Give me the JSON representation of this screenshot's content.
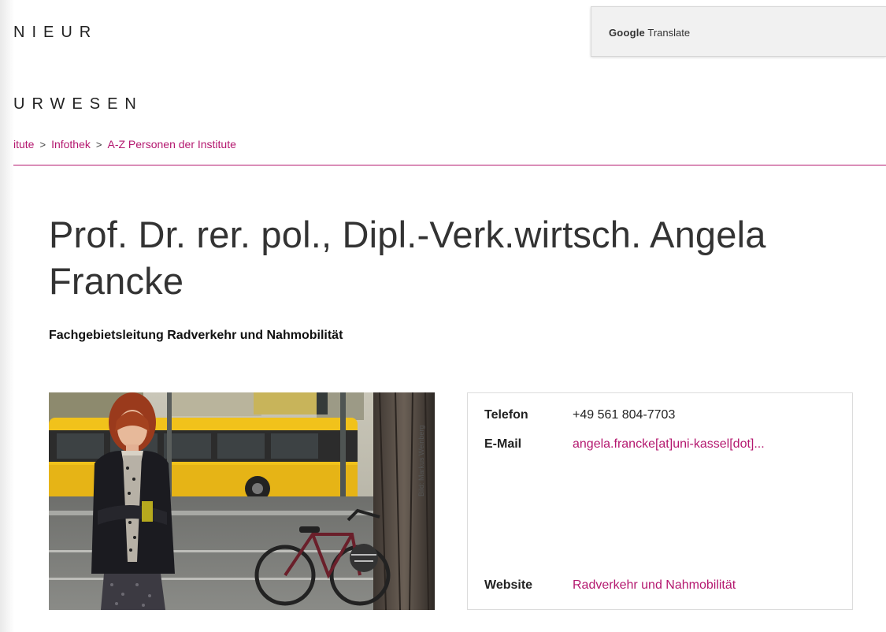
{
  "header": {
    "faculty_line1": "NIEUR",
    "faculty_line2": "URWESEN"
  },
  "translate": {
    "brand": "Google",
    "label": "Translate"
  },
  "breadcrumb": [
    {
      "label": "itute"
    },
    {
      "label": "Infothek"
    },
    {
      "label": "A-Z Personen der Institute"
    }
  ],
  "breadcrumb_separator": ">",
  "person": {
    "title": "Prof. Dr. rer. pol., Dipl.-Verk.wirtsch. Angela Francke",
    "subtitle": "Fachgebietsleitung Radverkehr und Nahmobilität",
    "photo_credit": "Bild: Markus Weinberg"
  },
  "contact": {
    "phone_label": "Telefon",
    "phone_value": "+49 561 804-7703",
    "email_label": "E-Mail",
    "email_value": "angela.francke[at]uni-kassel[dot]...",
    "website_label": "Website",
    "website_value": "Radverkehr und Nahmobilität"
  },
  "colors": {
    "accent": "#b4186f",
    "text": "#333333"
  }
}
